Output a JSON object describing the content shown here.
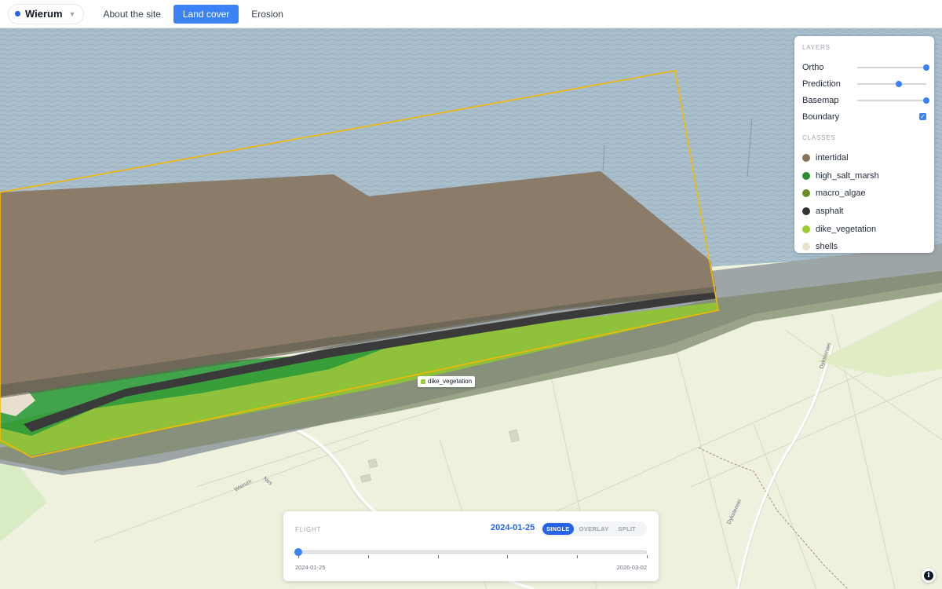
{
  "colors": {
    "accent": "#2563eb",
    "tab_active_bg": "#3b82f6",
    "slider_knob": "#3b82f6",
    "water": "#a9bfcc",
    "intertidal": "#8b7b69",
    "boundary": "#f5b800"
  },
  "icons": {
    "site_chevron": "chevron-down-icon",
    "boundary_check": "checkmark-icon",
    "info": "info-icon"
  },
  "header": {
    "site_name": "Wierum",
    "tabs": [
      {
        "label": "About the site",
        "active": false
      },
      {
        "label": "Land cover",
        "active": true
      },
      {
        "label": "Erosion",
        "active": false
      }
    ]
  },
  "layers_panel": {
    "layers_heading": "LAYERS",
    "layers": [
      {
        "label": "Ortho",
        "opacity": 1.0
      },
      {
        "label": "Prediction",
        "opacity": 0.6
      },
      {
        "label": "Basemap",
        "opacity": 1.0
      }
    ],
    "boundary": {
      "label": "Boundary",
      "checked": true
    },
    "classes_heading": "CLASSES",
    "classes": [
      {
        "label": "intertidal",
        "color": "#8b7358"
      },
      {
        "label": "high_salt_marsh",
        "color": "#2e8b2e"
      },
      {
        "label": "macro_algae",
        "color": "#6b8e23"
      },
      {
        "label": "asphalt",
        "color": "#333333"
      },
      {
        "label": "dike_vegetation",
        "color": "#9acd32"
      },
      {
        "label": "shells",
        "color": "#eadfcd"
      }
    ]
  },
  "map": {
    "hover_label": {
      "text": "dike_vegetation",
      "color": "#9acd32"
    },
    "street_labels": [
      "Wierum",
      "Nes",
      "Dyksterwei",
      "Dyksterwei"
    ]
  },
  "flight": {
    "label": "FLIGHT",
    "current_date": "2024-01-25",
    "modes": [
      {
        "label": "SINGLE",
        "active": true
      },
      {
        "label": "OVERLAY",
        "active": false
      },
      {
        "label": "SPLIT",
        "active": false
      }
    ],
    "start_date": "2024-01-25",
    "end_date": "2026-03-02",
    "position": 0.0,
    "tick_count": 6
  },
  "info_button": {
    "label": "i"
  }
}
